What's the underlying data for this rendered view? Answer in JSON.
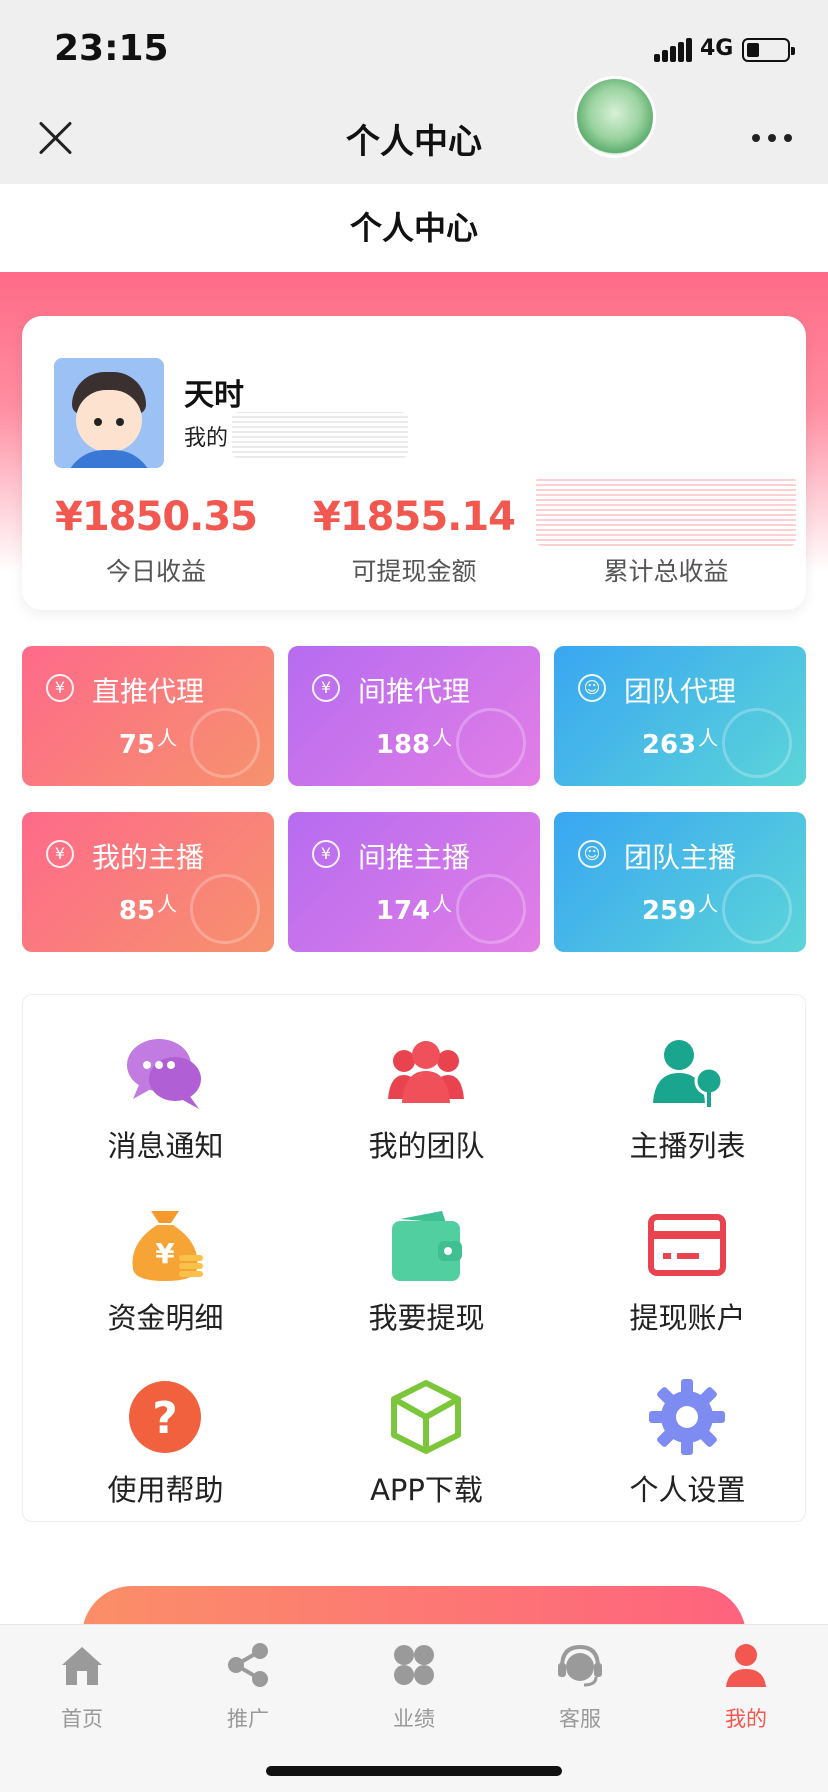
{
  "status_bar": {
    "time": "23:15",
    "network": "4G"
  },
  "header": {
    "title": "个人中心"
  },
  "page": {
    "title": "个人中心"
  },
  "profile": {
    "name": "天时",
    "subtitle": "我的",
    "stats": [
      {
        "value": "¥1850.35",
        "label": "今日收益"
      },
      {
        "value": "¥1855.14",
        "label": "可提现金额"
      },
      {
        "value": "",
        "label": "累计总收益"
      }
    ]
  },
  "tiles": [
    {
      "title": "直推代理",
      "count": "75",
      "unit": "人",
      "icon": "money-bag-icon"
    },
    {
      "title": "间推代理",
      "count": "188",
      "unit": "人",
      "icon": "yen-refresh-icon"
    },
    {
      "title": "团队代理",
      "count": "263",
      "unit": "人",
      "icon": "team-icon"
    },
    {
      "title": "我的主播",
      "count": "85",
      "unit": "人",
      "icon": "money-bag-icon"
    },
    {
      "title": "间推主播",
      "count": "174",
      "unit": "人",
      "icon": "yen-refresh-icon"
    },
    {
      "title": "团队主播",
      "count": "259",
      "unit": "人",
      "icon": "team-icon"
    }
  ],
  "menu": [
    {
      "label": "消息通知",
      "icon": "chat-bubbles-icon"
    },
    {
      "label": "我的团队",
      "icon": "team-icon"
    },
    {
      "label": "主播列表",
      "icon": "user-tree-icon"
    },
    {
      "label": "资金明细",
      "icon": "money-bag-icon"
    },
    {
      "label": "我要提现",
      "icon": "wallet-icon"
    },
    {
      "label": "提现账户",
      "icon": "card-icon"
    },
    {
      "label": "使用帮助",
      "icon": "help-icon"
    },
    {
      "label": "APP下载",
      "icon": "cube-icon"
    },
    {
      "label": "个人设置",
      "icon": "gear-icon"
    }
  ],
  "tabbar": [
    {
      "label": "首页",
      "icon": "home-icon"
    },
    {
      "label": "推广",
      "icon": "share-icon"
    },
    {
      "label": "业绩",
      "icon": "clover-icon"
    },
    {
      "label": "客服",
      "icon": "headset-icon"
    },
    {
      "label": "我的",
      "icon": "user-icon",
      "active": true
    }
  ],
  "colors": {
    "accent": "#f2584f",
    "hero": "#ff6a85"
  }
}
